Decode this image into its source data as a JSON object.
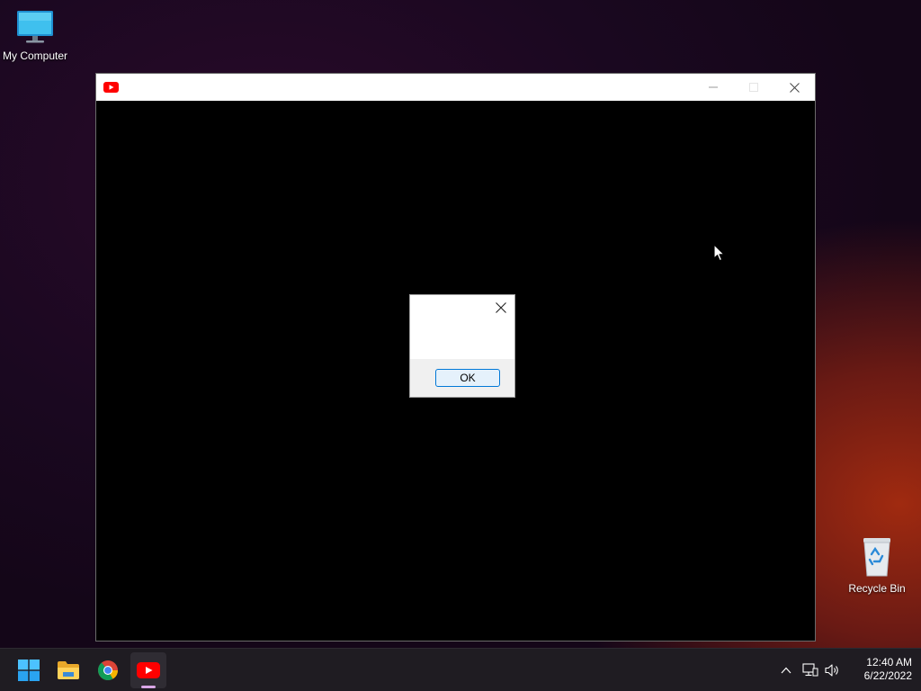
{
  "desktop": {
    "icons": [
      {
        "label": "My Computer",
        "icon": "monitor-icon"
      },
      {
        "label": "Recycle Bin",
        "icon": "recycle-bin-icon"
      }
    ]
  },
  "app_window": {
    "title": "",
    "icon": "youtube-icon",
    "controls": {
      "minimize": "minimize-icon",
      "maximize": "maximize-icon",
      "close": "close-icon"
    }
  },
  "dialog": {
    "message": "",
    "ok_label": "OK",
    "close_icon": "close-icon"
  },
  "taskbar": {
    "apps": [
      {
        "name": "Start",
        "icon": "windows-start-icon"
      },
      {
        "name": "File Explorer",
        "icon": "folder-icon"
      },
      {
        "name": "Google Chrome",
        "icon": "chrome-icon"
      },
      {
        "name": "YouTube",
        "icon": "youtube-icon",
        "active": true
      }
    ],
    "tray": {
      "icons": [
        "chevron-up-icon",
        "network-icon",
        "volume-icon"
      ],
      "time": "12:40 AM",
      "date": "6/22/2022"
    }
  },
  "colors": {
    "youtube_red": "#ff0000",
    "accent": "#0078d7",
    "taskbar": "#1f1c22"
  }
}
